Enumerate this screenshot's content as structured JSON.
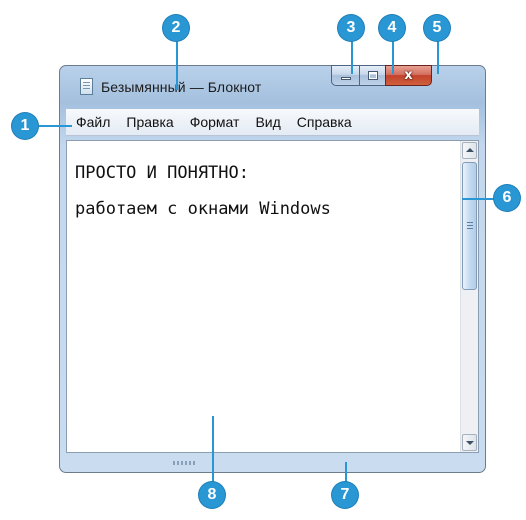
{
  "window": {
    "title": "Безымянный — Блокнот",
    "close_glyph": "x",
    "icons": {
      "app": "notepad-icon",
      "minimize": "minimize-icon",
      "maximize": "maximize-icon",
      "close": "close-icon",
      "scroll_up": "arrow-up-icon",
      "scroll_down": "arrow-down-icon"
    },
    "accent_color": "#2a97d5",
    "close_color": "#c2412b"
  },
  "menu": {
    "items": [
      {
        "label": "Файл"
      },
      {
        "label": "Правка"
      },
      {
        "label": "Формат"
      },
      {
        "label": "Вид"
      },
      {
        "label": "Справка"
      }
    ]
  },
  "editor": {
    "lines": [
      "ПРОСТО И ПОНЯТНО:",
      "работаем с окнами Windows"
    ]
  },
  "callouts": [
    "1",
    "2",
    "3",
    "4",
    "5",
    "6",
    "7",
    "8"
  ]
}
